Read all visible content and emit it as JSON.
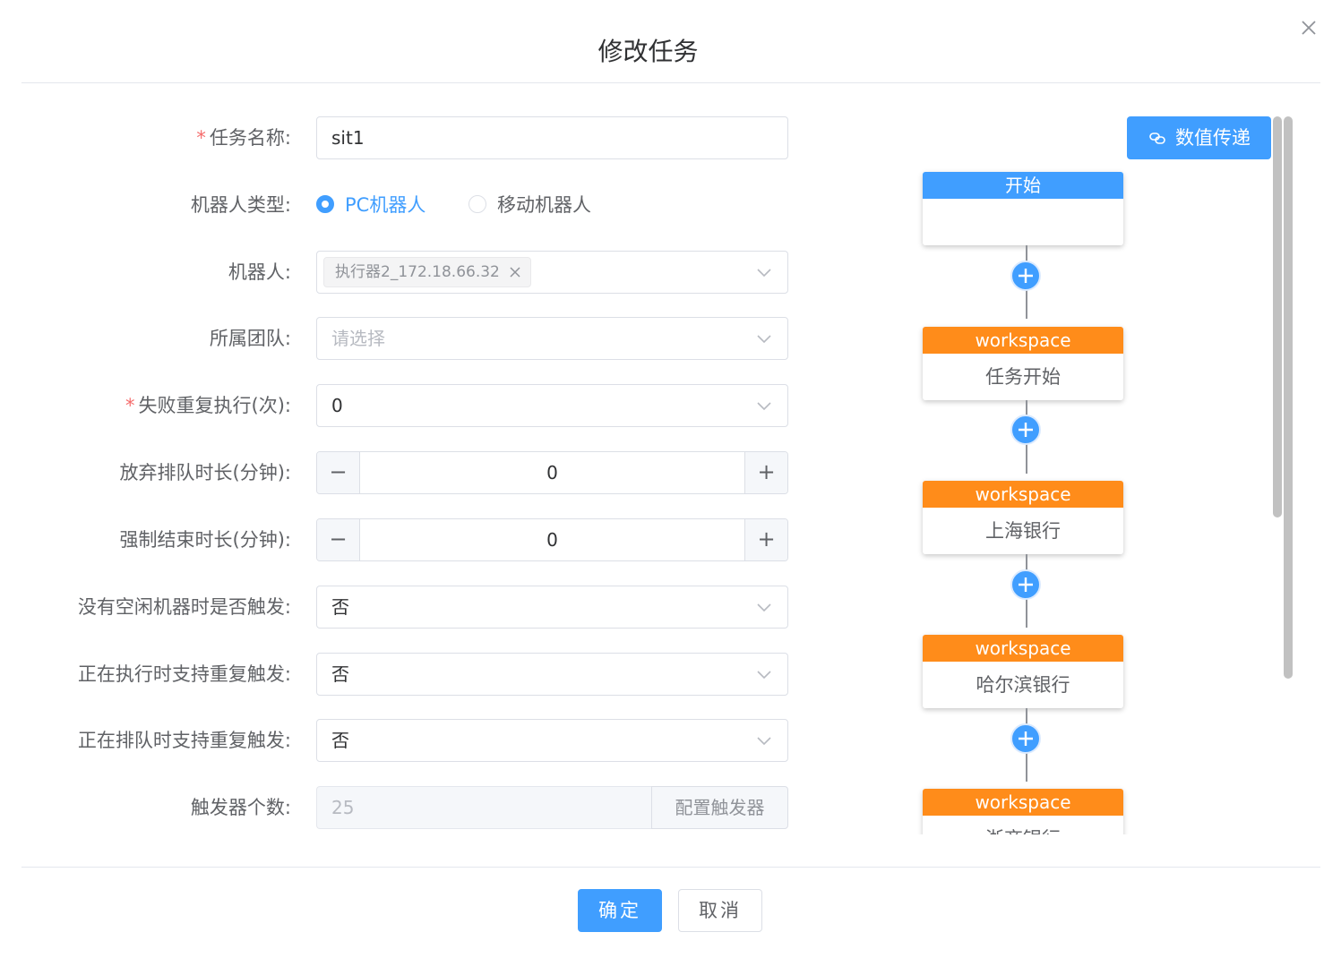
{
  "dialog": {
    "title": "修改任务"
  },
  "form": {
    "task_name": {
      "label": "任务名称:",
      "value": "sit1",
      "required": true
    },
    "robot_type": {
      "label": "机器人类型:",
      "options": [
        "PC机器人",
        "移动机器人"
      ],
      "selected": "PC机器人"
    },
    "robot": {
      "label": "机器人:",
      "tag": "执行器2_172.18.66.32"
    },
    "team": {
      "label": "所属团队:",
      "placeholder": "请选择"
    },
    "retry": {
      "label": "失败重复执行(次):",
      "value": "0",
      "required": true
    },
    "queue_timeout": {
      "label": "放弃排队时长(分钟):",
      "value": "0",
      "minus": "−",
      "plus": "+"
    },
    "force_end": {
      "label": "强制结束时长(分钟):",
      "value": "0",
      "minus": "−",
      "plus": "+"
    },
    "no_idle_trigger": {
      "label": "没有空闲机器时是否触发:",
      "value": "否"
    },
    "running_repeat": {
      "label": "正在执行时支持重复触发:",
      "value": "否"
    },
    "queue_repeat": {
      "label": "正在排队时支持重复触发:",
      "value": "否"
    },
    "trigger_count": {
      "label": "触发器个数:",
      "value": "25",
      "button": "配置触发器"
    }
  },
  "flow": {
    "value_pass_label": "数值传递",
    "nodes": [
      {
        "head": "开始",
        "body": "",
        "color": "#409eff"
      },
      {
        "head": "workspace",
        "body": "任务开始",
        "color": "#ff8c1a"
      },
      {
        "head": "workspace",
        "body": "上海银行",
        "color": "#ff8c1a"
      },
      {
        "head": "workspace",
        "body": "哈尔滨银行",
        "color": "#ff8c1a"
      },
      {
        "head": "workspace",
        "body": "浙商银行",
        "color": "#ff8c1a"
      }
    ]
  },
  "footer": {
    "confirm": "确定",
    "cancel": "取消"
  },
  "colors": {
    "primary": "#409eff",
    "accent": "#ff8c1a",
    "required": "#f56c6c"
  }
}
